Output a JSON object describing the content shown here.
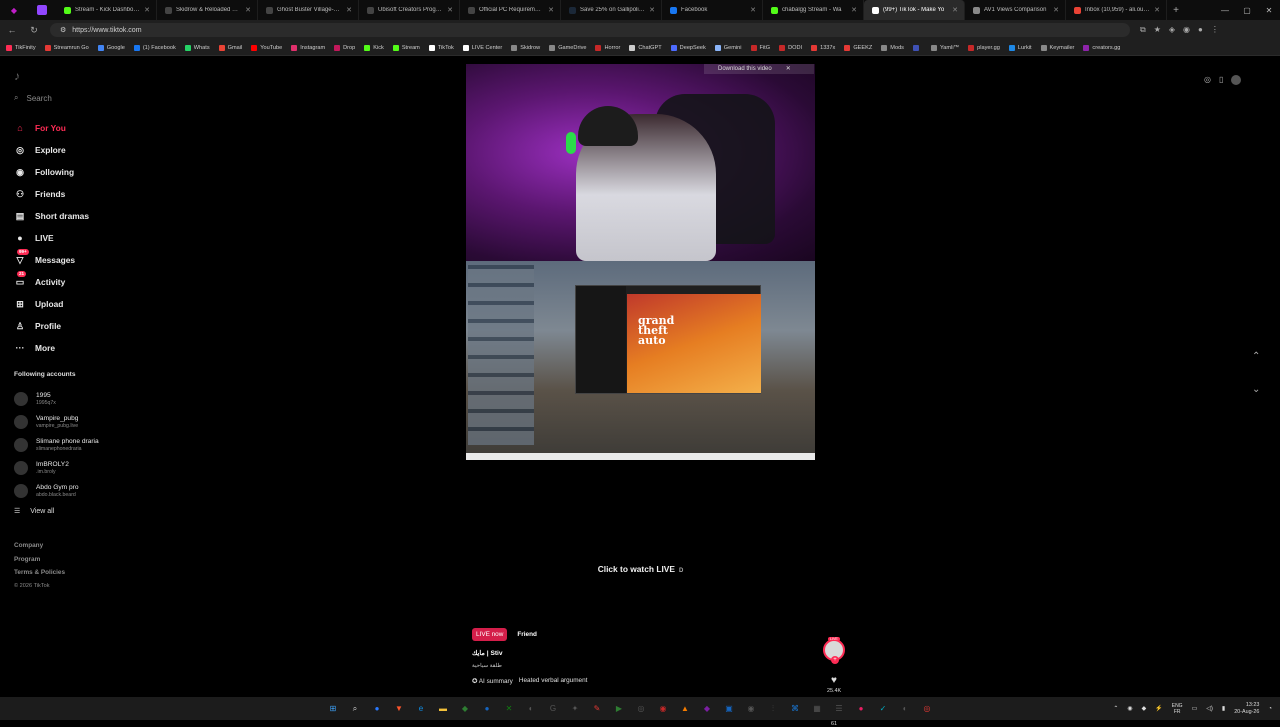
{
  "browser": {
    "tabs": [
      {
        "title": "Stream - Kick Dashboard",
        "color": "#53fc18"
      },
      {
        "title": "Skidrow & Reloaded Gam",
        "color": "#444444"
      },
      {
        "title": "Ghost Buster Village-P2P",
        "color": "#444444"
      },
      {
        "title": "Ubisoft Creators Program",
        "color": "#444444"
      },
      {
        "title": "Official PC Requirements",
        "color": "#444444"
      },
      {
        "title": "Save 25% on Gallipoli on",
        "color": "#1b2838"
      },
      {
        "title": "Facebook",
        "color": "#1877f2"
      },
      {
        "title": "chabalgg Stream - Wa",
        "color": "#53fc18"
      },
      {
        "title": "(99+) TikTok - Make Yo",
        "color": "#ffffff",
        "active": true
      },
      {
        "title": "AV1 Views Comparison",
        "color": "#888888"
      },
      {
        "title": "Inbox (10,959) - ali.ouche",
        "color": "#ea4335"
      }
    ],
    "url": "https://www.tiktok.com",
    "bookmarks": [
      {
        "label": "TikFinity",
        "color": "#fe2c55"
      },
      {
        "label": "Streamrun Go",
        "color": "#e53935"
      },
      {
        "label": "Google",
        "color": "#4285f4"
      },
      {
        "label": "(1) Facebook",
        "color": "#1877f2"
      },
      {
        "label": "Whats",
        "color": "#25d366"
      },
      {
        "label": "Gmail",
        "color": "#ea4335"
      },
      {
        "label": "YouTube",
        "color": "#ff0000"
      },
      {
        "label": "Instagram",
        "color": "#e1306c"
      },
      {
        "label": "Drop",
        "color": "#c2185b"
      },
      {
        "label": "Kick",
        "color": "#53fc18"
      },
      {
        "label": "Stream",
        "color": "#53fc18"
      },
      {
        "label": "TikTok",
        "color": "#ffffff"
      },
      {
        "label": "LIVE Center",
        "color": "#ffffff"
      },
      {
        "label": "Skidrow",
        "color": "#888888"
      },
      {
        "label": "GameDrive",
        "color": "#888888"
      },
      {
        "label": "Horror",
        "color": "#c62828"
      },
      {
        "label": "ChatGPT",
        "color": "#cccccc"
      },
      {
        "label": "DeepSeek",
        "color": "#4d6bfe"
      },
      {
        "label": "Gemini",
        "color": "#8ab4f8"
      },
      {
        "label": "FitG",
        "color": "#c62828"
      },
      {
        "label": "DODI",
        "color": "#c62828"
      },
      {
        "label": "1337x",
        "color": "#e53935"
      },
      {
        "label": "GEEKZ",
        "color": "#e53935"
      },
      {
        "label": "Mods",
        "color": "#888888"
      },
      {
        "label": "",
        "color": "#3f51b5"
      },
      {
        "label": "Yamli™",
        "color": "#888888"
      },
      {
        "label": "player.gg",
        "color": "#c62828"
      },
      {
        "label": "Lurkit",
        "color": "#1e88e5"
      },
      {
        "label": "Keymailer",
        "color": "#888888"
      },
      {
        "label": "creators.gg",
        "color": "#8e24aa"
      }
    ]
  },
  "sidebar": {
    "search_placeholder": "Search",
    "nav": [
      {
        "label": "For You",
        "icon": "home-icon",
        "glyph": "⌂",
        "active": true
      },
      {
        "label": "Explore",
        "icon": "compass-icon",
        "glyph": "◎"
      },
      {
        "label": "Following",
        "icon": "following-icon",
        "glyph": "◉"
      },
      {
        "label": "Friends",
        "icon": "friends-icon",
        "glyph": "⚇"
      },
      {
        "label": "Short dramas",
        "icon": "short-dramas-icon",
        "glyph": "▤"
      },
      {
        "label": "LIVE",
        "icon": "live-icon",
        "glyph": "●"
      },
      {
        "label": "Messages",
        "icon": "messages-icon",
        "glyph": "▽",
        "badge": "99+"
      },
      {
        "label": "Activity",
        "icon": "activity-icon",
        "glyph": "▭",
        "badge": "21"
      },
      {
        "label": "Upload",
        "icon": "upload-icon",
        "glyph": "⊞"
      },
      {
        "label": "Profile",
        "icon": "profile-icon",
        "glyph": "♙"
      },
      {
        "label": "More",
        "icon": "more-icon",
        "glyph": "···"
      }
    ],
    "following_heading": "Following accounts",
    "accounts": [
      {
        "name": "1995",
        "handle": "1995q7x"
      },
      {
        "name": "Vampire_pubg",
        "handle": "vampire_pubg.live"
      },
      {
        "name": "Slimane phone draria",
        "handle": "slimanephonedraria"
      },
      {
        "name": "ImBROLY2",
        "handle": ".im.broly"
      },
      {
        "name": "Abdo Gym pro",
        "handle": "abdo.black.beard"
      }
    ],
    "view_all": "View all",
    "footer": [
      "Company",
      "Program",
      "Terms & Policies"
    ],
    "copyright": "© 2026 TikTok"
  },
  "video": {
    "download_label": "Download this video",
    "game_title": "grand theft auto",
    "watch_label": "Click to watch LIVE",
    "watch_key": "D",
    "live_chip": "LIVE now",
    "friend_chip": "Friend",
    "caption": "مايك | Stiv",
    "caption_sub": "طلقة سياحية",
    "ai_label": "AI summary",
    "ai_summary": "Heated verbal argument",
    "live_badge": "LIVE",
    "likes": "25.4K",
    "shares": "61"
  },
  "taskbar": {
    "lang_top": "ENG",
    "lang_bottom": "FR",
    "time": "13:23",
    "date": "20-Aug-26",
    "apps": [
      {
        "name": "windows-start-icon",
        "color": "#3da0f5",
        "glyph": "⊞"
      },
      {
        "name": "search-icon",
        "color": "#1c1c1c",
        "glyph": "⌕"
      },
      {
        "name": "app-icon",
        "color": "#2979ff",
        "glyph": "●"
      },
      {
        "name": "brave-icon",
        "color": "#fb542b",
        "glyph": "▼"
      },
      {
        "name": "edge-icon",
        "color": "#0f8ee6",
        "glyph": "e"
      },
      {
        "name": "file-explorer-icon",
        "color": "#f3c13a",
        "glyph": "▬"
      },
      {
        "name": "app-icon",
        "color": "#2e7d32",
        "glyph": "◆"
      },
      {
        "name": "app-icon",
        "color": "#1565c0",
        "glyph": "●"
      },
      {
        "name": "xbox-icon",
        "color": "#107c10",
        "glyph": "✕"
      },
      {
        "name": "app-icon",
        "color": "#555555",
        "glyph": "◐"
      },
      {
        "name": "app-icon",
        "color": "#555555",
        "glyph": "G"
      },
      {
        "name": "app-icon",
        "color": "#555555",
        "glyph": "✦"
      },
      {
        "name": "app-icon",
        "color": "#e53935",
        "glyph": "✎"
      },
      {
        "name": "app-icon",
        "color": "#2e7d32",
        "glyph": "▶"
      },
      {
        "name": "app-icon",
        "color": "#555555",
        "glyph": "◎"
      },
      {
        "name": "app-icon",
        "color": "#c62828",
        "glyph": "◉"
      },
      {
        "name": "app-icon",
        "color": "#f57c00",
        "glyph": "▲"
      },
      {
        "name": "app-icon",
        "color": "#7b1fa2",
        "glyph": "◆"
      },
      {
        "name": "app-icon",
        "color": "#1565c0",
        "glyph": "▣"
      },
      {
        "name": "app-icon",
        "color": "#555555",
        "glyph": "◉"
      },
      {
        "name": "app-icon",
        "color": "#555555",
        "glyph": "⫶"
      },
      {
        "name": "app-icon",
        "color": "#1976d2",
        "glyph": "⌘"
      },
      {
        "name": "app-icon",
        "color": "#555555",
        "glyph": "▦"
      },
      {
        "name": "app-icon",
        "color": "#555555",
        "glyph": "☰"
      },
      {
        "name": "app-icon",
        "color": "#e91e63",
        "glyph": "●"
      },
      {
        "name": "app-icon",
        "color": "#00acc1",
        "glyph": "✓"
      },
      {
        "name": "app-icon",
        "color": "#555555",
        "glyph": "◐"
      },
      {
        "name": "app-icon",
        "color": "#e53935",
        "glyph": "◎"
      }
    ]
  }
}
